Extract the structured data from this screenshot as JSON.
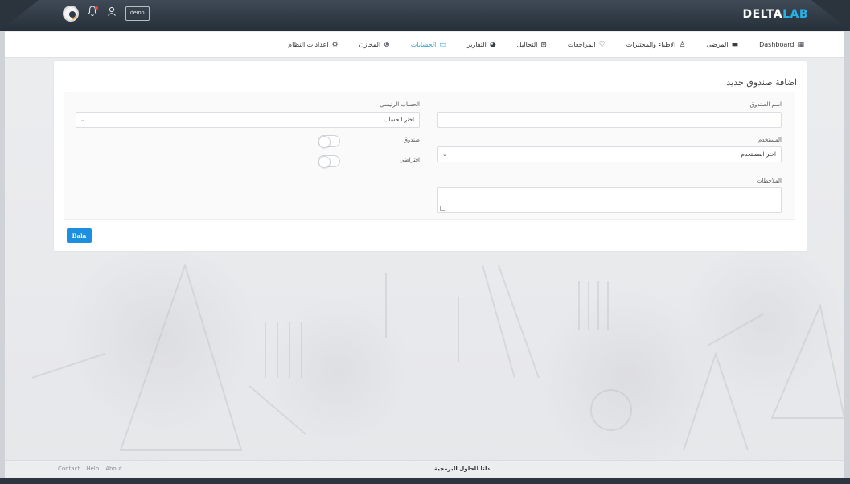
{
  "brand": {
    "part1": "DELTA",
    "part2": "LAB"
  },
  "topbar": {
    "user_button": "demo"
  },
  "nav": {
    "items": [
      {
        "label": "Dashboard",
        "icon": "dashboard-grid-icon"
      },
      {
        "label": "المرضى",
        "icon": "bed-icon"
      },
      {
        "label": "الاطباء والمختبرات",
        "icon": "doctor-icon"
      },
      {
        "label": "المراجعات",
        "icon": "heart-pulse-icon"
      },
      {
        "label": "التحاليل",
        "icon": "briefcase-medical-icon"
      },
      {
        "label": "التقارير",
        "icon": "pie-chart-icon"
      },
      {
        "label": "الحسابات",
        "icon": "money-icon"
      },
      {
        "label": "المخازن",
        "icon": "warehouse-icon"
      },
      {
        "label": "اعدادات النظام",
        "icon": "gear-icon"
      }
    ],
    "active_index": 6
  },
  "form": {
    "title": "اضافة صندوق جديد",
    "box_name_label": "اسم الصندوق",
    "box_name_value": "",
    "user_label": "المستخدم",
    "user_select_value": "اختر المستخدم",
    "notes_label": "الملاحظات",
    "main_account_label": "الحساب الرئيسي",
    "main_account_select_value": "اختر الحساب",
    "box_toggle_label": "صندوق",
    "box_toggle_on": false,
    "default_toggle_label": "افتراضي",
    "default_toggle_on": false,
    "save_label": "Bala"
  },
  "footer": {
    "links": [
      "Contact",
      "Help",
      "About"
    ],
    "company": "دلتا للحلول البرمجية"
  },
  "colors": {
    "accent": "#27b1e6",
    "active_nav": "#2b9fd8",
    "button": "#1d8fe0",
    "topbar": "#2f3943"
  }
}
